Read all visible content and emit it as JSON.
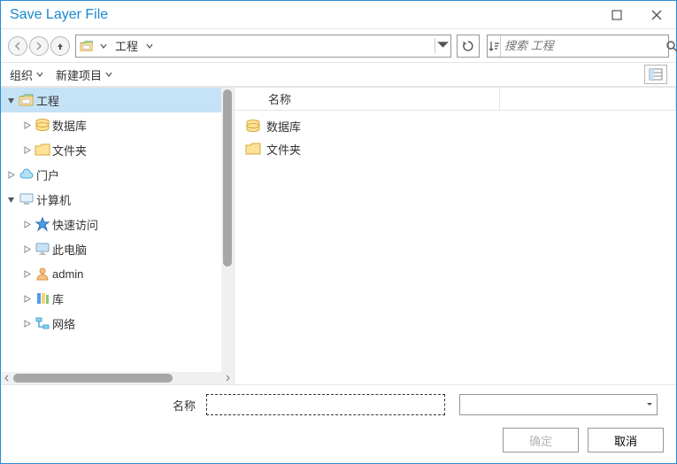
{
  "title": "Save Layer File",
  "path": {
    "current": "工程"
  },
  "search": {
    "placeholder": "搜索 工程"
  },
  "menu": {
    "organize": "组织",
    "newItem": "新建项目"
  },
  "tree": {
    "items": [
      {
        "label": "工程",
        "expanded": true,
        "selected": true,
        "level": 0,
        "icon": "folder-open"
      },
      {
        "label": "数据库",
        "expanded": false,
        "level": 1,
        "icon": "database"
      },
      {
        "label": "文件夹",
        "expanded": false,
        "level": 1,
        "icon": "folder"
      },
      {
        "label": "门户",
        "expanded": false,
        "level": 0,
        "icon": "cloud"
      },
      {
        "label": "计算机",
        "expanded": true,
        "level": 0,
        "icon": "computer"
      },
      {
        "label": "快速访问",
        "expanded": false,
        "level": 1,
        "icon": "star"
      },
      {
        "label": "此电脑",
        "expanded": false,
        "level": 1,
        "icon": "monitor"
      },
      {
        "label": "admin",
        "expanded": false,
        "level": 1,
        "icon": "user"
      },
      {
        "label": "库",
        "expanded": false,
        "level": 1,
        "icon": "library"
      },
      {
        "label": "网络",
        "expanded": false,
        "level": 1,
        "icon": "network"
      }
    ]
  },
  "columns": {
    "name": "名称"
  },
  "files": [
    {
      "label": "数据库",
      "icon": "database"
    },
    {
      "label": "文件夹",
      "icon": "folder"
    }
  ],
  "footer": {
    "nameLabel": "名称",
    "nameValue": "",
    "ok": "确定",
    "cancel": "取消"
  }
}
